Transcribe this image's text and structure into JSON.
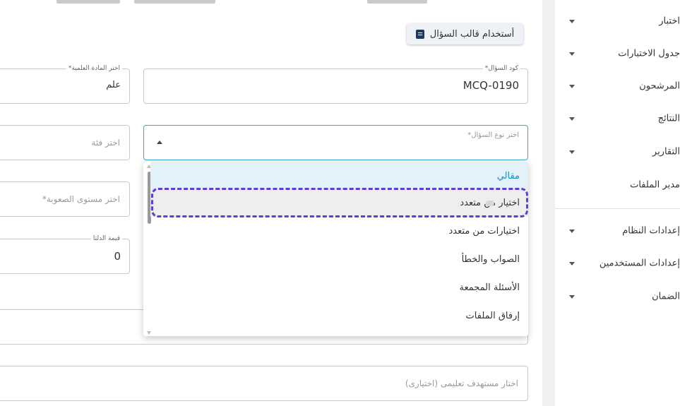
{
  "toolbar": {
    "template_label": "أستخدام قالب السؤال",
    "template_icon": "document-icon"
  },
  "form": {
    "question_code": {
      "legend": "كود السؤال*",
      "value": "MCQ-0190"
    },
    "subject": {
      "legend": "اختر المادة العلمية*",
      "value": "علم"
    },
    "question_type": {
      "label": "اختر نوع السؤال*"
    },
    "category": {
      "placeholder": "اختر فئة"
    },
    "difficulty": {
      "placeholder": "اختر مستوى الصعوبة*"
    },
    "delta": {
      "legend": "قيمة الدلتا",
      "value": "0"
    },
    "learning_target": {
      "placeholder": "اختار مستهدف تعليمى (اختيارى)"
    }
  },
  "dropdown": {
    "options": [
      "مقالي",
      "اختيار من متعدد",
      "اختيارات من متعدد",
      "الصواب والخطأ",
      "الأسئلة المجمعة",
      "إرفاق الملفات"
    ],
    "active_index": 0,
    "hovered_index": 1
  },
  "sidebar": {
    "items": [
      {
        "label": "اختبار",
        "has_caret": true
      },
      {
        "label": "جدول الاختبارات",
        "has_caret": true
      },
      {
        "label": "المرشحون",
        "has_caret": true
      },
      {
        "label": "النتائج",
        "has_caret": true
      },
      {
        "label": "التقارير",
        "has_caret": true
      },
      {
        "label": "مدير الملفات",
        "has_caret": false
      },
      {
        "label": "إعدادات النظام",
        "has_caret": true
      },
      {
        "label": "إعدادات المستخدمين",
        "has_caret": true
      },
      {
        "label": "الضمان",
        "has_caret": true
      }
    ]
  },
  "colors": {
    "accent": "#3aa6c9",
    "highlight": "#5b3fd6",
    "active_option": "#1b8fbc"
  }
}
